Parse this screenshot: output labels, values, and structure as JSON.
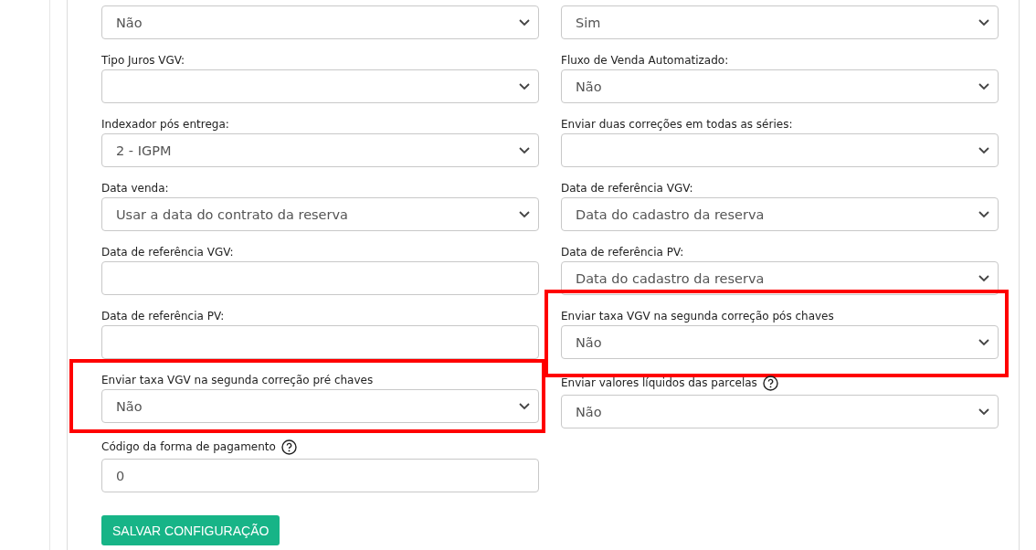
{
  "columns": [
    {
      "fields": [
        {
          "kind": "select",
          "value": "Não",
          "help": false,
          "highlighted": false
        },
        {
          "label": "Tipo Juros VGV:",
          "kind": "select",
          "help": false,
          "highlighted": false
        },
        {
          "label": "Indexador pós entrega:",
          "kind": "select",
          "value": "2 - IGPM",
          "help": false,
          "highlighted": false
        },
        {
          "label": "Data venda:",
          "kind": "select",
          "value": "Usar a data do contrato da reserva",
          "help": false,
          "highlighted": false
        },
        {
          "label": "Data de referência VGV:",
          "kind": "input",
          "help": false,
          "highlighted": false
        },
        {
          "label": "Data de referência PV:",
          "kind": "input",
          "help": false,
          "highlighted": false
        },
        {
          "label": "Enviar taxa VGV na segunda correção pré chaves",
          "kind": "select",
          "value": "Não",
          "help": false,
          "highlighted": true
        },
        {
          "label": "Código da forma de pagamento",
          "kind": "input",
          "value": "0",
          "help": true,
          "highlighted": false
        }
      ]
    },
    {
      "fields": [
        {
          "kind": "select",
          "value": "Sim",
          "help": false,
          "highlighted": false
        },
        {
          "label": "Fluxo de Venda Automatizado:",
          "kind": "select",
          "value": "Não",
          "help": false,
          "highlighted": false
        },
        {
          "label": "Enviar duas correções em todas as séries:",
          "kind": "select",
          "help": false,
          "highlighted": false
        },
        {
          "label": "Data de referência VGV:",
          "kind": "select",
          "value": "Data do cadastro da reserva",
          "help": false,
          "highlighted": false
        },
        {
          "label": "Data de referência PV:",
          "kind": "select",
          "value": "Data do cadastro da reserva",
          "help": false,
          "highlighted": false
        },
        {
          "label": "Enviar taxa VGV na segunda correção pós chaves",
          "kind": "select",
          "value": "Não",
          "help": false,
          "highlighted": true
        },
        {
          "label": "Enviar valores líquidos das parcelas",
          "kind": "select",
          "value": "Não",
          "help": true,
          "highlighted": false
        }
      ]
    }
  ],
  "save_button": "SALVAR CONFIGURAÇÃO"
}
